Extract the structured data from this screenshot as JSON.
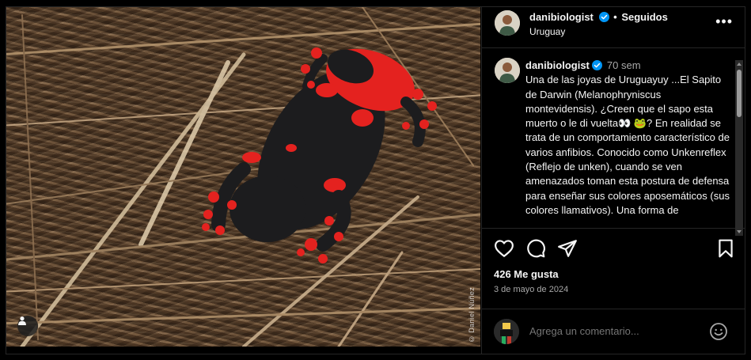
{
  "post": {
    "photo_credit": "© Daniel Núñez",
    "photo_subject": "Sapito de Darwin (Melanophryniscus montevidensis)"
  },
  "header": {
    "username": "danibiologist",
    "separator": "•",
    "follow_state": "Seguidos",
    "location": "Uruguay",
    "more_icon": "more-horizontal-icon"
  },
  "caption": {
    "username": "danibiologist",
    "time_ago": "70 sem",
    "text": "Una de las joyas de Uruguayuy ...El Sapito de Darwin (Melanophryniscus montevidensis). ¿Creen que el sapo esta muerto o le di vuelta👀 🐸? En realidad se trata de un comportamiento característico de varios anfibios. Conocido como Unkenreflex (Reflejo de unken), cuando se ven amenazados toman esta postura de defensa para enseñar sus colores aposemáticos (sus colores llamativos). Una forma de"
  },
  "actions": {
    "like_icon": "heart-icon",
    "comment_icon": "comment-icon",
    "share_icon": "paper-plane-icon",
    "save_icon": "bookmark-icon"
  },
  "likes": {
    "label": "426 Me gusta"
  },
  "date": {
    "label": "3 de mayo de 2024"
  },
  "comment_box": {
    "placeholder": "Agrega un comentario...",
    "emoji_icon": "smiley-icon"
  },
  "colors": {
    "background": "#000000",
    "text": "#f5f5f5",
    "secondary_text": "#a8a8a8",
    "verified_badge": "#0095f6",
    "divider": "#262626",
    "frog_red": "#e4221f",
    "frog_black": "#1c1c1e"
  }
}
